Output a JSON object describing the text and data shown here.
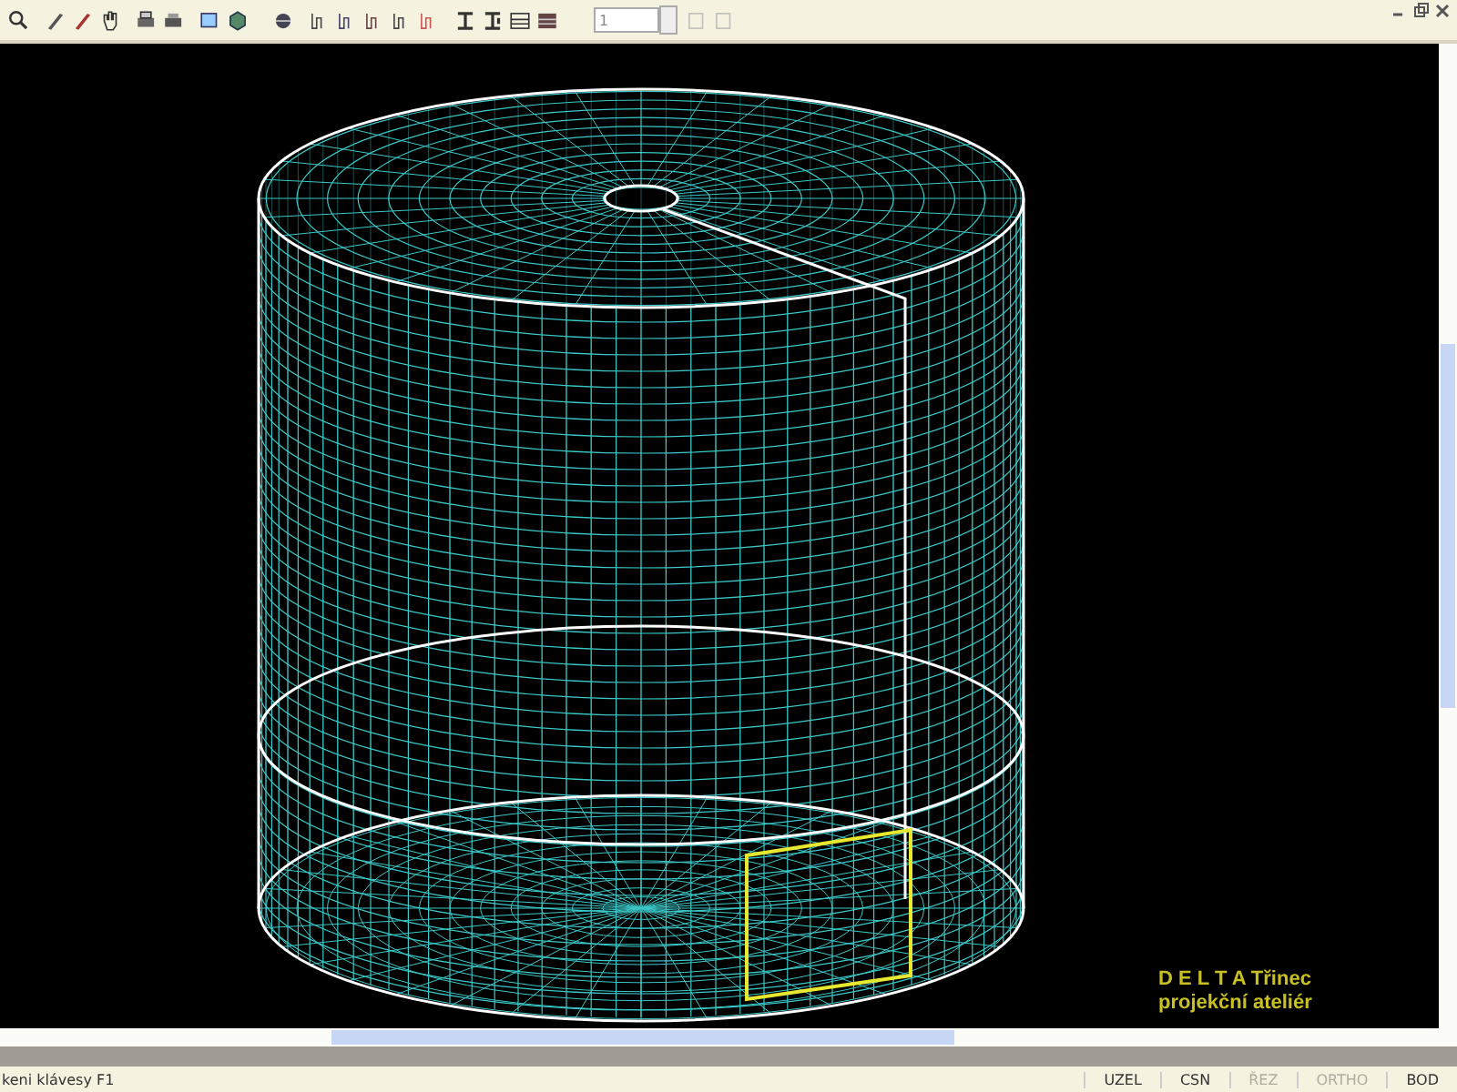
{
  "toolbar": {
    "page_field": {
      "value": "1"
    }
  },
  "viewport": {
    "logo": {
      "title": "D E L T A Třinec",
      "subtitle": "projekční ateliér"
    }
  },
  "status_bar": {
    "hint": "keni klávesy F1",
    "indicators": [
      {
        "label": "UZEL",
        "disabled": false
      },
      {
        "label": "CSN",
        "disabled": false
      },
      {
        "label": "ŘEZ",
        "disabled": true
      },
      {
        "label": "ORTHO",
        "disabled": true
      },
      {
        "label": "BOD",
        "disabled": false
      }
    ]
  }
}
